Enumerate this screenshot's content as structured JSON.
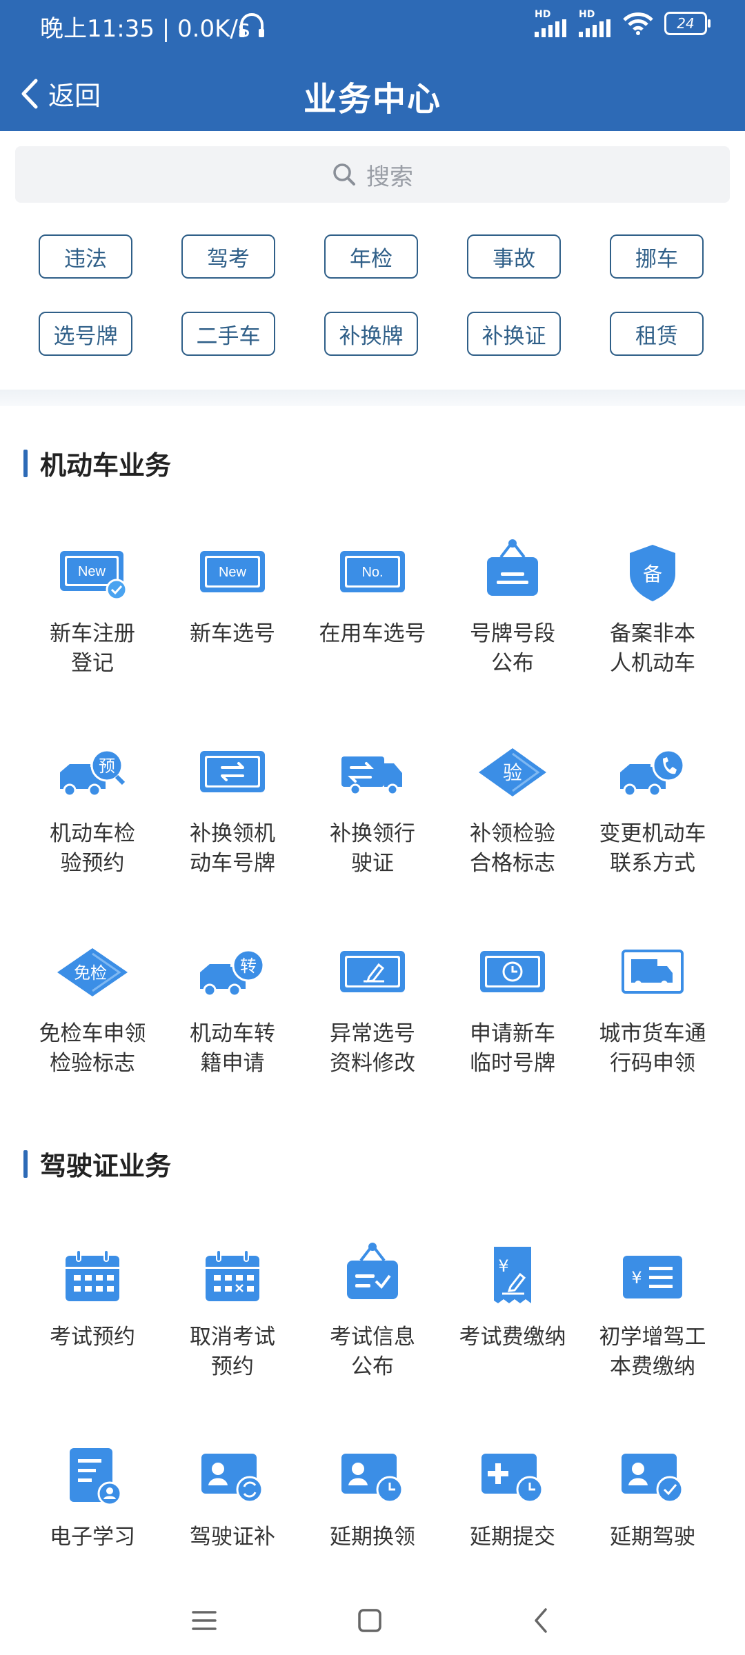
{
  "status": {
    "time": "晚上11:35 | 0.0K/s",
    "hd1": "HD",
    "hd2": "HD",
    "battery": "24"
  },
  "nav": {
    "back_label": "返回",
    "title": "业务中心"
  },
  "search": {
    "placeholder": "搜索"
  },
  "tags": {
    "row1": [
      "违法",
      "驾考",
      "年检",
      "事故",
      "挪车"
    ],
    "row2": [
      "选号牌",
      "二手车",
      "补换牌",
      "补换证",
      "租赁"
    ]
  },
  "sections": {
    "vehicle": {
      "title": "机动车业务",
      "items": [
        {
          "label": "新车注册\n登记",
          "icon": "new-plate-check-icon"
        },
        {
          "label": "新车选号",
          "icon": "new-plate-icon"
        },
        {
          "label": "在用车选号",
          "icon": "no-plate-icon"
        },
        {
          "label": "号牌号段\n公布",
          "icon": "notice-board-icon"
        },
        {
          "label": "备案非本\n人机动车",
          "icon": "shield-record-icon"
        },
        {
          "label": "机动车检\n验预约",
          "icon": "truck-appointment-icon"
        },
        {
          "label": "补换领机\n动车号牌",
          "icon": "plate-exchange-icon"
        },
        {
          "label": "补换领行\n驶证",
          "icon": "license-exchange-icon"
        },
        {
          "label": "补领检验\n合格标志",
          "icon": "inspection-diamond-icon"
        },
        {
          "label": "变更机动车\n联系方式",
          "icon": "truck-phone-icon"
        },
        {
          "label": "免检车申领\n检验标志",
          "icon": "exempt-diamond-icon"
        },
        {
          "label": "机动车转\n籍申请",
          "icon": "truck-transfer-icon"
        },
        {
          "label": "异常选号\n资料修改",
          "icon": "edit-plate-icon"
        },
        {
          "label": "申请新车\n临时号牌",
          "icon": "temp-plate-clock-icon"
        },
        {
          "label": "城市货车通\n行码申领",
          "icon": "freight-truck-icon"
        }
      ]
    },
    "license": {
      "title": "驾驶证业务",
      "items": [
        {
          "label": "考试预约",
          "icon": "calendar-icon"
        },
        {
          "label": "取消考试\n预约",
          "icon": "calendar-cancel-icon"
        },
        {
          "label": "考试信息\n公布",
          "icon": "notice-check-icon"
        },
        {
          "label": "考试费缴纳",
          "icon": "receipt-yuan-icon"
        },
        {
          "label": "初学增驾工\n本费缴纳",
          "icon": "yuan-list-icon"
        },
        {
          "label": "电子学习",
          "icon": "document-user-icon"
        },
        {
          "label": "驾驶证补",
          "icon": "id-card-exchange-icon"
        },
        {
          "label": "延期换领",
          "icon": "id-card-clock-icon"
        },
        {
          "label": "延期提交",
          "icon": "medical-clock-icon"
        },
        {
          "label": "延期驾驶",
          "icon": "id-card-check-icon"
        }
      ]
    }
  },
  "colors": {
    "primary": "#2d6ab6",
    "icon_blue": "#3b8ee6",
    "tag_border": "#2f5f88"
  }
}
